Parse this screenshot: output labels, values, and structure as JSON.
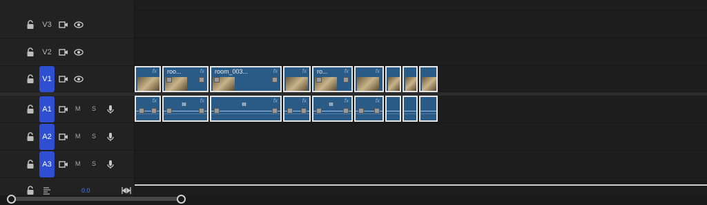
{
  "tracks": [
    {
      "id": "v3",
      "label": "V3",
      "type": "video",
      "target": false
    },
    {
      "id": "v2",
      "label": "V2",
      "type": "video",
      "target": false
    },
    {
      "id": "v1",
      "label": "V1",
      "type": "video",
      "target": true
    },
    {
      "id": "a1",
      "label": "A1",
      "type": "audio",
      "target": true,
      "mute": "M",
      "solo": "S"
    },
    {
      "id": "a2",
      "label": "A2",
      "type": "audio",
      "target": true,
      "mute": "M",
      "solo": "S"
    },
    {
      "id": "a3",
      "label": "A3",
      "type": "audio",
      "target": true,
      "mute": "M",
      "solo": "S"
    }
  ],
  "master": {
    "value": "0.0"
  },
  "video_clips": [
    {
      "name": "",
      "fx": "fx"
    },
    {
      "name": "roo...",
      "fx": "fx"
    },
    {
      "name": "room_003...",
      "fx": "fx"
    },
    {
      "name": "",
      "fx": "fx"
    },
    {
      "name": "ro...",
      "fx": "fx"
    },
    {
      "name": "",
      "fx": "fx"
    },
    {
      "name": "",
      "fx": "fx"
    },
    {
      "name": "",
      "fx": "fx"
    },
    {
      "name": "",
      "fx": "fx"
    }
  ],
  "audio_clips": [
    {
      "fx": "fx",
      "wave": ""
    },
    {
      "fx": "fx",
      "wave": "ıııı"
    },
    {
      "fx": "fx",
      "wave": "ıııı"
    },
    {
      "fx": "fx",
      "wave": ""
    },
    {
      "fx": "fx",
      "wave": "ıııı"
    },
    {
      "fx": "fx",
      "wave": ""
    },
    {
      "fx": "",
      "wave": ""
    },
    {
      "fx": "",
      "wave": ""
    },
    {
      "fx": "",
      "wave": ""
    }
  ],
  "colors": {
    "target": "#2f4fd2",
    "clip": "#2a5a86",
    "clip_border": "#e6e6e6"
  },
  "icons": {
    "lock": "lock-icon",
    "camera": "camera-icon",
    "eye": "eye-icon",
    "mic": "mic-icon",
    "wave": "audio-wave-icon",
    "fit": "fit-icon"
  }
}
